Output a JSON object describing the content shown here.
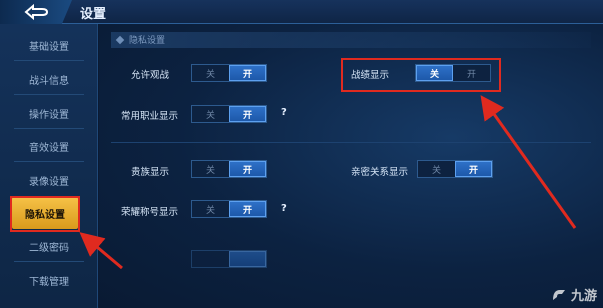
{
  "header": {
    "title": "设置"
  },
  "sidebar": {
    "items": [
      {
        "label": "基础设置"
      },
      {
        "label": "战斗信息"
      },
      {
        "label": "操作设置"
      },
      {
        "label": "音效设置"
      },
      {
        "label": "录像设置"
      },
      {
        "label": "隐私设置",
        "active": true
      },
      {
        "label": "二级密码"
      },
      {
        "label": "下载管理"
      }
    ]
  },
  "main": {
    "section_title": "隐私设置",
    "rows": {
      "allow_watch": {
        "label": "允许观战",
        "off": "关",
        "on": "开",
        "value": "开"
      },
      "record_display": {
        "label": "战绩显示",
        "off": "关",
        "on": "开",
        "value": "关"
      },
      "common_job_display": {
        "label": "常用职业显示",
        "off": "关",
        "on": "开",
        "value": "开"
      },
      "noble_display": {
        "label": "贵族显示",
        "off": "关",
        "on": "开",
        "value": "开"
      },
      "intimate_display": {
        "label": "亲密关系显示",
        "off": "关",
        "on": "开",
        "value": "开"
      },
      "honor_title_display": {
        "label": "荣耀称号显示",
        "off": "关",
        "on": "开",
        "value": "开"
      }
    },
    "help_mark": "?"
  },
  "watermark": {
    "text": "九游"
  },
  "colors": {
    "accent_gold": "#e9ae2f",
    "toggle_on": "#2a6bc2",
    "annotation_red": "#e02a1f"
  },
  "icons": {
    "back": "back-arrow-icon",
    "section": "diamond-bullet-icon",
    "watermark": "jiuyou-logo-icon"
  }
}
